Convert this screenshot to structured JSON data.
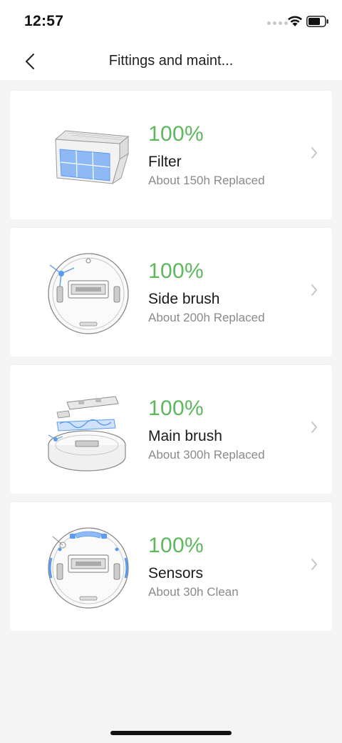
{
  "status_bar": {
    "time": "12:57"
  },
  "header": {
    "title": "Fittings and maint..."
  },
  "items": [
    {
      "percent": "100%",
      "name": "Filter",
      "status": "About 150h Replaced",
      "icon": "filter-icon"
    },
    {
      "percent": "100%",
      "name": "Side brush",
      "status": "About 200h Replaced",
      "icon": "side-brush-robot-icon"
    },
    {
      "percent": "100%",
      "name": "Main brush",
      "status": "About 300h Replaced",
      "icon": "main-brush-robot-icon"
    },
    {
      "percent": "100%",
      "name": "Sensors",
      "status": "About 30h Clean",
      "icon": "sensors-robot-icon"
    }
  ],
  "colors": {
    "accent_green": "#5cb85c",
    "highlight_blue": "#5b9bf0",
    "background": "#f4f4f4"
  }
}
